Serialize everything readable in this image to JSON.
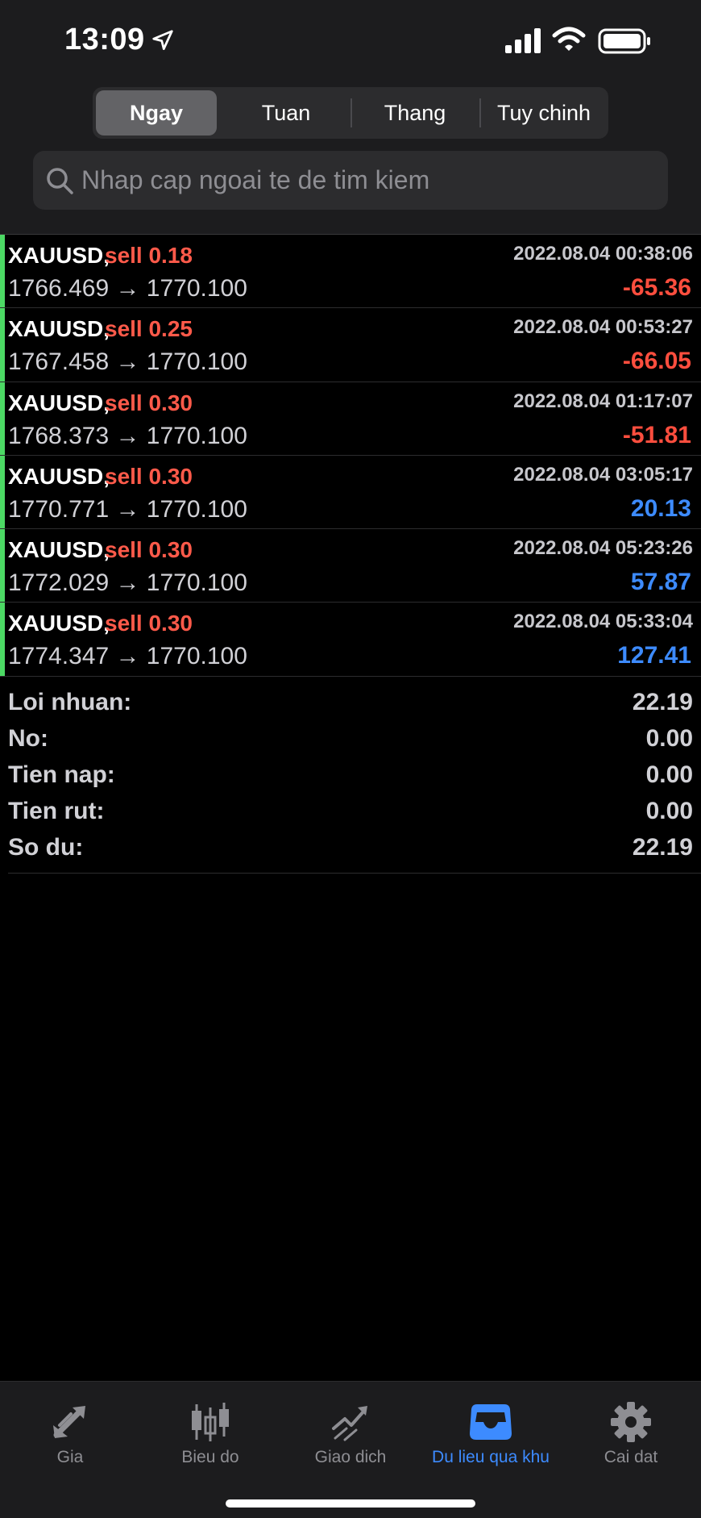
{
  "status_bar": {
    "time": "13:09"
  },
  "period_tabs": [
    {
      "label": "Ngay",
      "active": true
    },
    {
      "label": "Tuan",
      "active": false
    },
    {
      "label": "Thang",
      "active": false
    },
    {
      "label": "Tuy chinh",
      "active": false
    }
  ],
  "search": {
    "placeholder": "Nhap cap ngoai te de tim kiem",
    "value": ""
  },
  "deals": [
    {
      "symbol": "XAUUSD,",
      "side": "sell 0.18",
      "time": "2022.08.04 00:38:06",
      "prices": "1766.469 → 1770.100",
      "profit": "-65.36"
    },
    {
      "symbol": "XAUUSD,",
      "side": "sell 0.25",
      "time": "2022.08.04 00:53:27",
      "prices": "1767.458 → 1770.100",
      "profit": "-66.05"
    },
    {
      "symbol": "XAUUSD,",
      "side": "sell 0.30",
      "time": "2022.08.04 01:17:07",
      "prices": "1768.373 → 1770.100",
      "profit": "-51.81"
    },
    {
      "symbol": "XAUUSD,",
      "side": "sell 0.30",
      "time": "2022.08.04 03:05:17",
      "prices": "1770.771 → 1770.100",
      "profit": "20.13"
    },
    {
      "symbol": "XAUUSD,",
      "side": "sell 0.30",
      "time": "2022.08.04 05:23:26",
      "prices": "1772.029 → 1770.100",
      "profit": "57.87"
    },
    {
      "symbol": "XAUUSD,",
      "side": "sell 0.30",
      "time": "2022.08.04 05:33:04",
      "prices": "1774.347 → 1770.100",
      "profit": "127.41"
    }
  ],
  "summary": [
    {
      "label": "Loi nhuan:",
      "value": "22.19"
    },
    {
      "label": "No:",
      "value": "0.00"
    },
    {
      "label": "Tien nap:",
      "value": "0.00"
    },
    {
      "label": "Tien rut:",
      "value": "0.00"
    },
    {
      "label": "So du:",
      "value": "22.19"
    }
  ],
  "tab_bar": [
    {
      "label": "Gia",
      "icon": "quotes-arrows-icon",
      "active": false
    },
    {
      "label": "Bieu do",
      "icon": "candlestick-chart-icon",
      "active": false
    },
    {
      "label": "Giao dich",
      "icon": "trade-chart-icon",
      "active": false
    },
    {
      "label": "Du lieu qua khu",
      "icon": "history-inbox-icon",
      "active": true
    },
    {
      "label": "Cai dat",
      "icon": "gear-icon",
      "active": false
    }
  ],
  "colors": {
    "loss": "#ff4e3e",
    "gain": "#3d8bff",
    "sell": "#ff5a4a",
    "accent": "#3d8bff",
    "deal_bar": "#4cd964"
  }
}
